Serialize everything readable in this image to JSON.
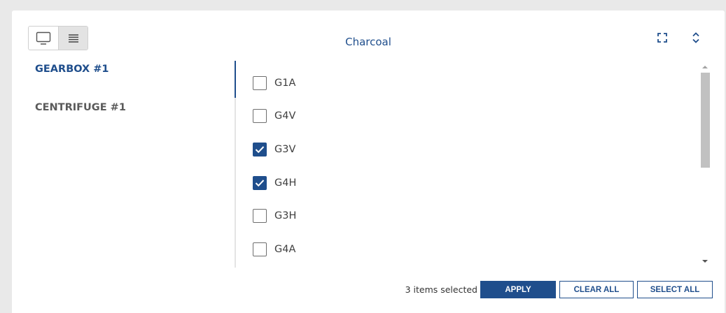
{
  "header": {
    "title": "Charcoal",
    "view_toggle": [
      {
        "icon": "monitor-icon",
        "active": false
      },
      {
        "icon": "list-icon",
        "active": true
      }
    ],
    "expand_icon": "expand-icon",
    "collapse_icon": "chevron-up-down-icon"
  },
  "assets": [
    {
      "label": "GEARBOX #1",
      "active": true
    },
    {
      "label": "CENTRIFUGE #1",
      "active": false
    }
  ],
  "options": [
    {
      "label": "G1A",
      "checked": false
    },
    {
      "label": "G4V",
      "checked": false
    },
    {
      "label": "G3V",
      "checked": true
    },
    {
      "label": "G4H",
      "checked": true
    },
    {
      "label": "G3H",
      "checked": false
    },
    {
      "label": "G4A",
      "checked": false
    }
  ],
  "footer": {
    "status": "3 items selected",
    "apply_label": "APPLY",
    "clear_label": "CLEAR ALL",
    "select_all_label": "SELECT ALL"
  },
  "colors": {
    "accent": "#1f4e8c",
    "background": "#e9e9e9",
    "inactive_text": "#5a5a5a"
  }
}
